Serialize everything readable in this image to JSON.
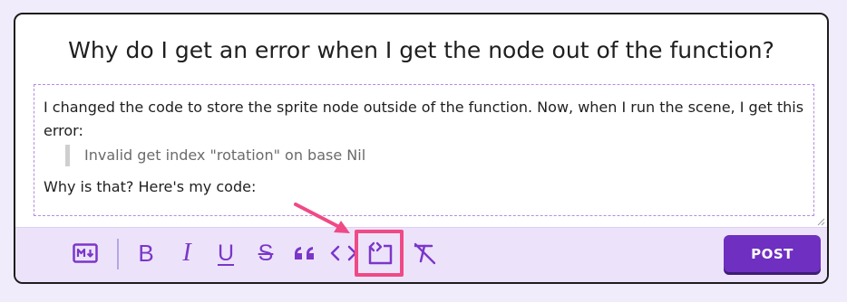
{
  "question": {
    "title": "Why do I get an error when I get the node out of the function?"
  },
  "editor": {
    "paragraph_1": "I changed the code to store the sprite node outside of the function. Now, when I run the scene, I get this error:",
    "quote": "Invalid get index \"rotation\" on base Nil",
    "paragraph_2": "Why is that? Here's my code:"
  },
  "toolbar": {
    "markdown_icon": "markdown-icon",
    "bold_label": "B",
    "italic_label": "I",
    "underline_label": "U",
    "strikethrough_label": "S",
    "quote_icon": "quote-icon",
    "inline_code_icon": "inline-code-icon",
    "code_block_icon": "code-block-icon",
    "clear_format_icon": "clear-formatting-icon",
    "post_label": "POST"
  },
  "annotation": {
    "arrow_color": "#f04a86",
    "highlight_target": "code-block-button"
  },
  "colors": {
    "accent": "#7b36c9",
    "button": "#6f2fc0",
    "toolbar_bg": "#ece3fb",
    "page_bg": "#f1ecfb"
  }
}
